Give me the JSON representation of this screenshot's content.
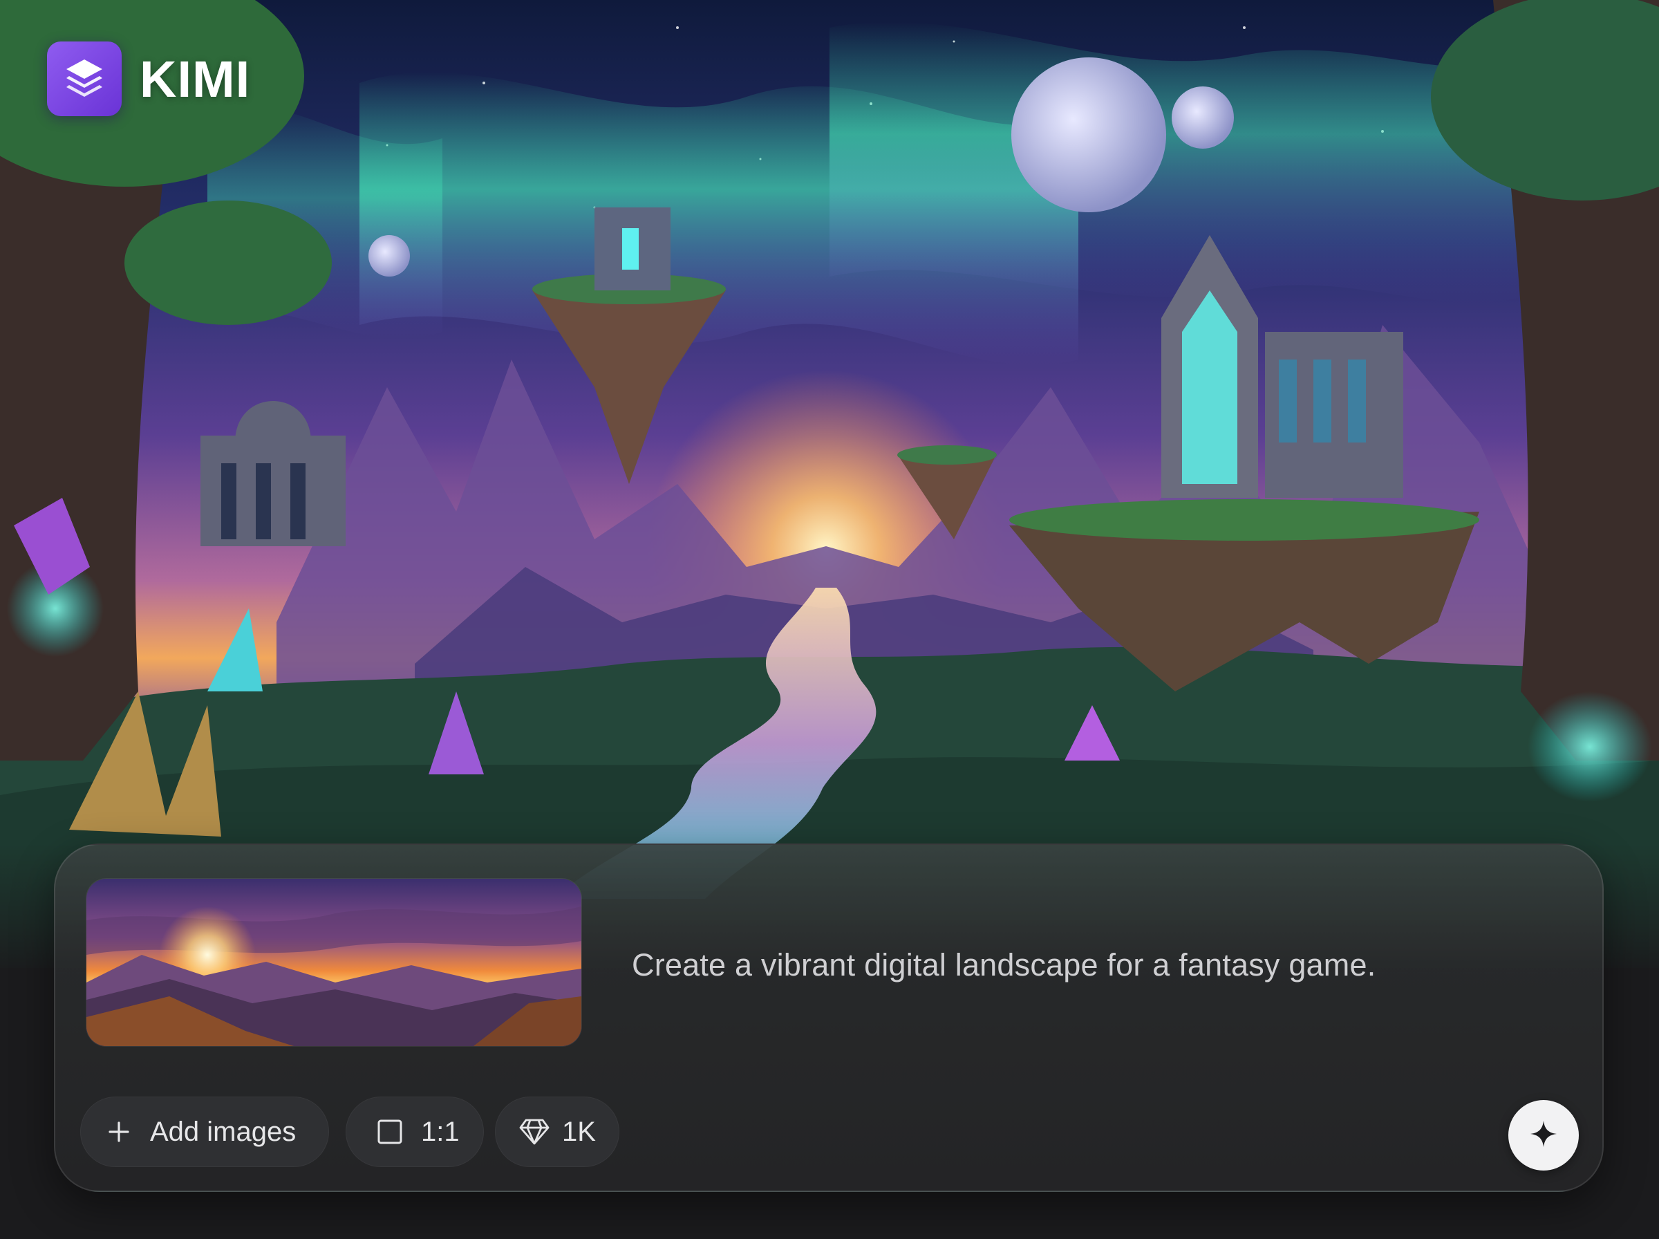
{
  "brand": {
    "name": "KIMI",
    "logo_icon": "layers-icon",
    "accent": "#7c46e6"
  },
  "prompt": {
    "text": "Create a vibrant digital landscape for a fantasy game."
  },
  "reference_image": {
    "description_icon": "image-thumbnail"
  },
  "toolbar": {
    "add_images": {
      "label": "Add images",
      "icon": "plus-icon"
    },
    "aspect_ratio": {
      "label": "1:1",
      "icon": "square-icon"
    },
    "resolution": {
      "label": "1K",
      "icon": "diamond-icon"
    },
    "generate": {
      "icon": "sparkle-icon"
    }
  },
  "colors": {
    "page_bg": "#1b1b1d",
    "composer_bg": "#262628",
    "chip_bg": "#2f3033",
    "send_bg": "#f2f2f3"
  }
}
